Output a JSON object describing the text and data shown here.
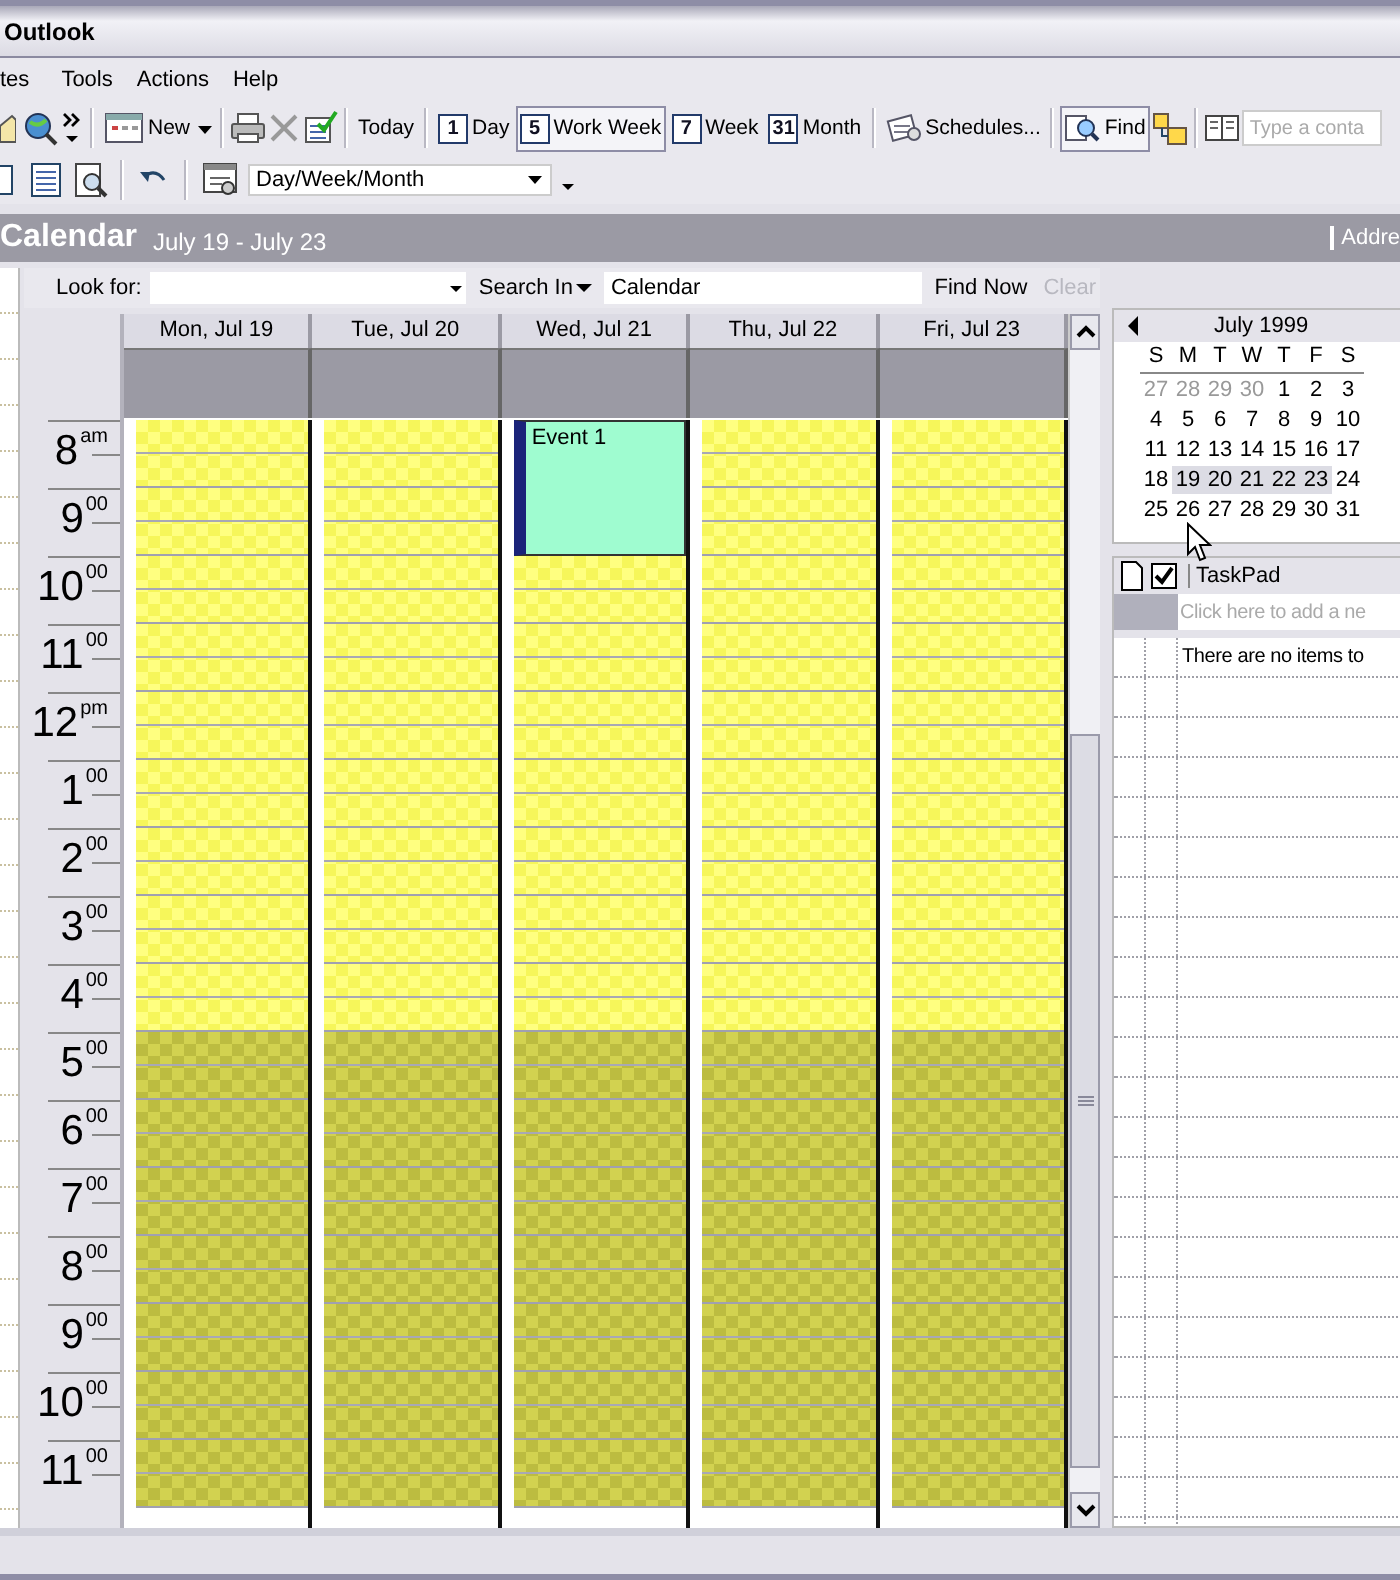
{
  "window": {
    "title": "Outlook"
  },
  "menu": [
    "tes",
    "Tools",
    "Actions",
    "Help"
  ],
  "toolbar": {
    "new": "New",
    "today": "Today",
    "views": [
      {
        "badge": "1",
        "label": "Day",
        "selected": false
      },
      {
        "badge": "5",
        "label": "Work Week",
        "selected": true
      },
      {
        "badge": "7",
        "label": "Week",
        "selected": false
      },
      {
        "badge": "31",
        "label": "Month",
        "selected": false
      }
    ],
    "schedules": "Schedules...",
    "find": {
      "label": "Find",
      "selected": true
    },
    "contact_search": {
      "placeholder": "Type a conta"
    }
  },
  "toolbar2": {
    "view_select": "Day/Week/Month"
  },
  "header": {
    "title": "Calendar",
    "range": "July 19 - July 23",
    "address": "Addre"
  },
  "find_bar": {
    "look_for": "Look for:",
    "search_in": "Search In",
    "search_in_value": "Calendar",
    "find_now": "Find Now",
    "clear": {
      "label": "Clear",
      "disabled": true
    }
  },
  "calendar": {
    "days": [
      {
        "label": "Mon, Jul 19"
      },
      {
        "label": "Tue, Jul 20"
      },
      {
        "label": "Wed, Jul 21",
        "events": [
          {
            "title": "Event 1",
            "busy": [
              true,
              true,
              false,
              false,
              false,
              false,
              false,
              false,
              false,
              false,
              false,
              false,
              false,
              false,
              false,
              false
            ]
          }
        ]
      },
      {
        "label": "Thu, Jul 22"
      },
      {
        "label": "Fri, Jul 23"
      }
    ],
    "hours": [
      {
        "hour": "8",
        "suffix": "am",
        "work": true
      },
      {
        "hour": "9",
        "suffix": "00",
        "work": true
      },
      {
        "hour": "10",
        "suffix": "00",
        "work": true
      },
      {
        "hour": "11",
        "suffix": "00",
        "work": true
      },
      {
        "hour": "12",
        "suffix": "pm",
        "work": true
      },
      {
        "hour": "1",
        "suffix": "00",
        "work": true
      },
      {
        "hour": "2",
        "suffix": "00",
        "work": true
      },
      {
        "hour": "3",
        "suffix": "00",
        "work": true
      },
      {
        "hour": "4",
        "suffix": "00",
        "work": true
      },
      {
        "hour": "5",
        "suffix": "00",
        "work": false
      },
      {
        "hour": "6",
        "suffix": "00",
        "work": false
      },
      {
        "hour": "7",
        "suffix": "00",
        "work": false
      },
      {
        "hour": "8",
        "suffix": "00",
        "work": false
      },
      {
        "hour": "9",
        "suffix": "00",
        "work": false
      },
      {
        "hour": "10",
        "suffix": "00",
        "work": false
      },
      {
        "hour": "11",
        "suffix": "00",
        "work": false
      }
    ]
  },
  "mini_calendar": {
    "title": "July 1999",
    "weekdays": [
      "S",
      "M",
      "T",
      "W",
      "T",
      "F",
      "S"
    ],
    "weeks": [
      [
        {
          "day": "27",
          "other_month": true,
          "selected": false
        },
        {
          "day": "28",
          "other_month": true,
          "selected": false
        },
        {
          "day": "29",
          "other_month": true,
          "selected": false
        },
        {
          "day": "30",
          "other_month": true,
          "selected": false
        },
        {
          "day": "1",
          "other_month": false,
          "selected": false
        },
        {
          "day": "2",
          "other_month": false,
          "selected": false
        },
        {
          "day": "3",
          "other_month": false,
          "selected": false
        }
      ],
      [
        {
          "day": "4",
          "other_month": false,
          "selected": false
        },
        {
          "day": "5",
          "other_month": false,
          "selected": false
        },
        {
          "day": "6",
          "other_month": false,
          "selected": false
        },
        {
          "day": "7",
          "other_month": false,
          "selected": false
        },
        {
          "day": "8",
          "other_month": false,
          "selected": false
        },
        {
          "day": "9",
          "other_month": false,
          "selected": false
        },
        {
          "day": "10",
          "other_month": false,
          "selected": false
        }
      ],
      [
        {
          "day": "11",
          "other_month": false,
          "selected": false
        },
        {
          "day": "12",
          "other_month": false,
          "selected": false
        },
        {
          "day": "13",
          "other_month": false,
          "selected": false
        },
        {
          "day": "14",
          "other_month": false,
          "selected": false
        },
        {
          "day": "15",
          "other_month": false,
          "selected": false
        },
        {
          "day": "16",
          "other_month": false,
          "selected": false
        },
        {
          "day": "17",
          "other_month": false,
          "selected": false
        }
      ],
      [
        {
          "day": "18",
          "other_month": false,
          "selected": false
        },
        {
          "day": "19",
          "other_month": false,
          "selected": true
        },
        {
          "day": "20",
          "other_month": false,
          "selected": true
        },
        {
          "day": "21",
          "other_month": false,
          "selected": true
        },
        {
          "day": "22",
          "other_month": false,
          "selected": true
        },
        {
          "day": "23",
          "other_month": false,
          "selected": true
        },
        {
          "day": "24",
          "other_month": false,
          "selected": false
        }
      ],
      [
        {
          "day": "25",
          "other_month": false,
          "selected": false
        },
        {
          "day": "26",
          "other_month": false,
          "selected": false
        },
        {
          "day": "27",
          "other_month": false,
          "selected": false
        },
        {
          "day": "28",
          "other_month": false,
          "selected": false
        },
        {
          "day": "29",
          "other_month": false,
          "selected": false
        },
        {
          "day": "30",
          "other_month": false,
          "selected": false
        },
        {
          "day": "31",
          "other_month": false,
          "selected": false
        }
      ]
    ]
  },
  "taskpad": {
    "title": "TaskPad",
    "new_task": {
      "placeholder": "Click here to add a ne"
    },
    "empty_message": "There are no items to"
  }
}
